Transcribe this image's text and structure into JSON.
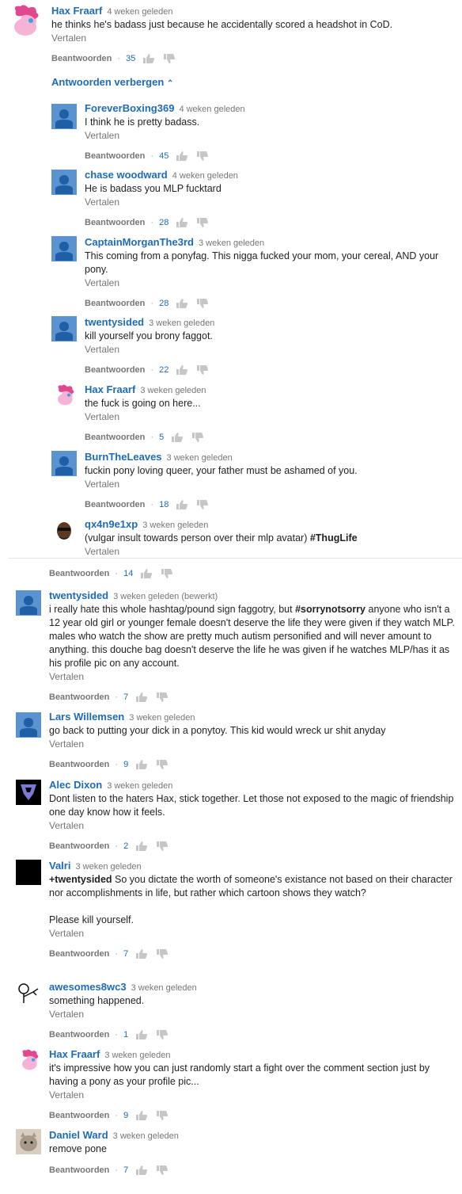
{
  "comments": [
    {
      "author": "Hax Fraarf",
      "time": "4 weken geleden",
      "text": "he thinks he's badass just because he accidentally scored a headshot in CoD.",
      "translate": "Vertalen",
      "reply": "Beantwoorden",
      "likes": "35",
      "avatar": "pony"
    },
    {
      "author": "ForeverBoxing369",
      "time": "4 weken geleden",
      "text": "I think he is pretty badass.",
      "translate": "Vertalen",
      "reply": "Beantwoorden",
      "likes": "45",
      "avatar": "default"
    },
    {
      "author": "chase woodward",
      "time": "4 weken geleden",
      "text": "He is badass you MLP fucktard",
      "translate": "Vertalen",
      "reply": "Beantwoorden",
      "likes": "28",
      "avatar": "default"
    },
    {
      "author": "CaptainMorganThe3rd",
      "time": "3 weken geleden",
      "text": "This coming from a ponyfag. This nigga fucked your mom, your cereal, AND your pony.",
      "translate": "Vertalen",
      "reply": "Beantwoorden",
      "likes": "28",
      "avatar": "default"
    },
    {
      "author": "twentysided",
      "time": "3 weken geleden",
      "text": "kill yourself you brony faggot.",
      "translate": "Vertalen",
      "reply": "Beantwoorden",
      "likes": "22",
      "avatar": "default"
    },
    {
      "author": "Hax Fraarf",
      "time": "3 weken geleden",
      "text": "the fuck is going on here...",
      "translate": "Vertalen",
      "reply": "Beantwoorden",
      "likes": "5",
      "avatar": "pony"
    },
    {
      "author": "BurnTheLeaves",
      "time": "3 weken geleden",
      "text": "fuckin pony loving queer, your father must be ashamed of you.",
      "translate": "Vertalen",
      "reply": "Beantwoorden",
      "likes": "18",
      "avatar": "default"
    },
    {
      "author": "qx4n9e1xp",
      "time": "3 weken geleden",
      "text_pre": "(vulgar insult towards person over their mlp avatar) ",
      "text_bold": "#ThugLife",
      "translate": "Vertalen",
      "reply": "Beantwoorden",
      "likes": "14",
      "avatar": "cartoon"
    },
    {
      "author": "twentysided",
      "time": "3 weken geleden (bewerkt)",
      "text_pre": "i really hate this whole hashtag/pound sign faggotry, but ",
      "text_bold": "#sorrynotsorry",
      "text_post": " anyone who isn't a 12 year old girl or younger female doesn't deserve the life they were given if they watch MLP. males who watch the show are pretty much autism personified and will never amount to anything. this douche bag doesn't deserve the life he was given if he watches MLP/has it as his profile pic on any account.",
      "translate": "Vertalen",
      "reply": "Beantwoorden",
      "likes": "7",
      "avatar": "default"
    },
    {
      "author": "Lars Willemsen",
      "time": "3 weken geleden",
      "text": "go back to putting your dick in a ponytoy. This kid would wreck ur shit anyday",
      "translate": "Vertalen",
      "reply": "Beantwoorden",
      "likes": "9",
      "avatar": "default"
    },
    {
      "author": "Alec Dixon",
      "time": "3 weken geleden",
      "text": "Dont listen to the haters Hax, stick together. Let those not exposed to the magic of friendship one day know how it feels.",
      "translate": "Vertalen",
      "reply": "Beantwoorden",
      "likes": "2",
      "avatar": "decepticon"
    },
    {
      "author": "Valri",
      "time": "3 weken geleden",
      "text_bold": "+twentysided",
      "text_post": " So you dictate the worth of someone's existance not based on their character nor accomplishments in life, but rather which cartoon shows they watch?\n\nPlease kill yourself.",
      "translate": "Vertalen",
      "reply": "Beantwoorden",
      "likes": "7",
      "avatar": "black"
    },
    {
      "author": "awesomes8wc3",
      "time": "3 weken geleden",
      "text": "something happened.",
      "translate": "Vertalen",
      "reply": "Beantwoorden",
      "likes": "1",
      "avatar": "stick"
    },
    {
      "author": "Hax Fraarf",
      "time": "3 weken geleden",
      "text": "it's impressive how you can just randomly start a fight over the comment section just by having a pony as your profile pic...",
      "translate": "Vertalen",
      "reply": "Beantwoorden",
      "likes": "9",
      "avatar": "pony"
    },
    {
      "author": "Daniel Ward",
      "time": "3 weken geleden",
      "text": "remove pone",
      "reply": "Beantwoorden",
      "likes": "7",
      "avatar": "cat"
    }
  ],
  "hide_replies_label": "Antwoorden verbergen",
  "colors": {
    "link": "#1e6bb8",
    "muted": "#767676",
    "avatar_default": "#5b93d1"
  }
}
